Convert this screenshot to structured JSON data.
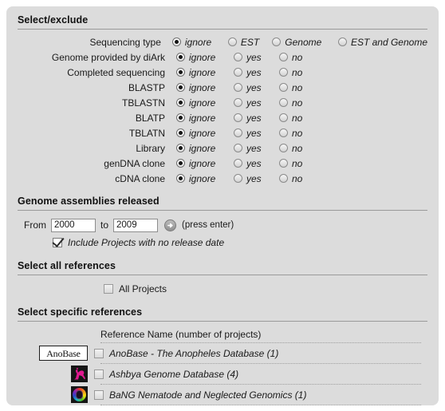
{
  "panel": {
    "background_color": "#dcdcdc",
    "frame_color": "#ffffff"
  },
  "sections": {
    "select_exclude": {
      "title": "Select/exclude"
    },
    "assemblies": {
      "title": "Genome assemblies released"
    },
    "all_references": {
      "title": "Select all references"
    },
    "specific_references": {
      "title": "Select specific references"
    }
  },
  "filters": [
    {
      "label": "Sequencing type",
      "options": [
        {
          "label": "ignore",
          "checked": true
        },
        {
          "label": "EST",
          "checked": false
        },
        {
          "label": "Genome",
          "checked": false
        },
        {
          "label": "EST and Genome",
          "checked": false
        }
      ]
    },
    {
      "label": "Genome provided by diArk",
      "options": [
        {
          "label": "ignore",
          "checked": true
        },
        {
          "label": "yes",
          "checked": false
        },
        {
          "label": "no",
          "checked": false
        }
      ]
    },
    {
      "label": "Completed sequencing",
      "options": [
        {
          "label": "ignore",
          "checked": true
        },
        {
          "label": "yes",
          "checked": false
        },
        {
          "label": "no",
          "checked": false
        }
      ]
    },
    {
      "label": "BLASTP",
      "options": [
        {
          "label": "ignore",
          "checked": true
        },
        {
          "label": "yes",
          "checked": false
        },
        {
          "label": "no",
          "checked": false
        }
      ]
    },
    {
      "label": "TBLASTN",
      "options": [
        {
          "label": "ignore",
          "checked": true
        },
        {
          "label": "yes",
          "checked": false
        },
        {
          "label": "no",
          "checked": false
        }
      ]
    },
    {
      "label": "BLATP",
      "options": [
        {
          "label": "ignore",
          "checked": true
        },
        {
          "label": "yes",
          "checked": false
        },
        {
          "label": "no",
          "checked": false
        }
      ]
    },
    {
      "label": "TBLATN",
      "options": [
        {
          "label": "ignore",
          "checked": true
        },
        {
          "label": "yes",
          "checked": false
        },
        {
          "label": "no",
          "checked": false
        }
      ]
    },
    {
      "label": "Library",
      "options": [
        {
          "label": "ignore",
          "checked": true
        },
        {
          "label": "yes",
          "checked": false
        },
        {
          "label": "no",
          "checked": false
        }
      ]
    },
    {
      "label": "genDNA clone",
      "options": [
        {
          "label": "ignore",
          "checked": true
        },
        {
          "label": "yes",
          "checked": false
        },
        {
          "label": "no",
          "checked": false
        }
      ]
    },
    {
      "label": "cDNA clone",
      "options": [
        {
          "label": "ignore",
          "checked": true
        },
        {
          "label": "yes",
          "checked": false
        },
        {
          "label": "no",
          "checked": false
        }
      ]
    }
  ],
  "assemblies": {
    "from_word": "From",
    "to_word": "to",
    "from_value": "2000",
    "to_value": "2009",
    "from_placeholder": "2000",
    "to_placeholder": "2009",
    "go_icon": "arrow-right-icon",
    "hint": "(press enter)",
    "include_checkbox": {
      "label": "Include Projects with no release date",
      "checked": true
    }
  },
  "all_references": {
    "checkbox": {
      "label": "All Projects",
      "checked": false
    }
  },
  "specific_references": {
    "column_header": "Reference Name (number of projects)",
    "rows": [
      {
        "logo_type": "wordmark",
        "logo_text": "AnoBase",
        "logo_name": "anobase-logo",
        "label": "AnoBase - The Anopheles Database (1)",
        "checked": false
      },
      {
        "logo_type": "ashbya",
        "logo_text": "",
        "logo_name": "ashbya-logo",
        "label": "Ashbya Genome Database (4)",
        "checked": false
      },
      {
        "logo_type": "bang",
        "logo_text": "",
        "logo_name": "bang-logo",
        "label": "BaNG Nematode and Neglected Genomics (1)",
        "checked": false
      }
    ]
  }
}
